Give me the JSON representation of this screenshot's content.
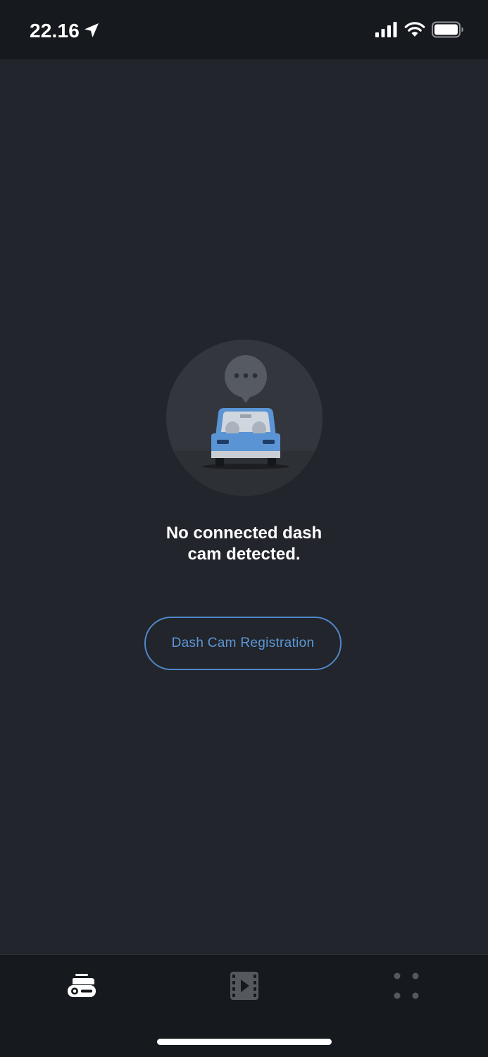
{
  "status_bar": {
    "time": "22.16",
    "icons": [
      "location-arrow-icon",
      "cellular-signal-icon",
      "wifi-icon",
      "battery-icon"
    ]
  },
  "empty_state": {
    "illustration": "car-with-speech-bubble",
    "message_line1": "No connected dash",
    "message_line2": "cam detected."
  },
  "registration_button": {
    "label": "Dash Cam Registration"
  },
  "tab_bar": {
    "tabs": [
      {
        "icon": "dash-cam-icon",
        "active": true
      },
      {
        "icon": "video-film-icon",
        "active": false
      },
      {
        "icon": "more-dots-icon",
        "active": false
      }
    ]
  },
  "colors": {
    "status_bar_bg": "#16191d",
    "content_bg": "#22252b",
    "accent": "#4e87c8",
    "text_primary": "#ffffff",
    "tab_inactive": "#55585d"
  }
}
